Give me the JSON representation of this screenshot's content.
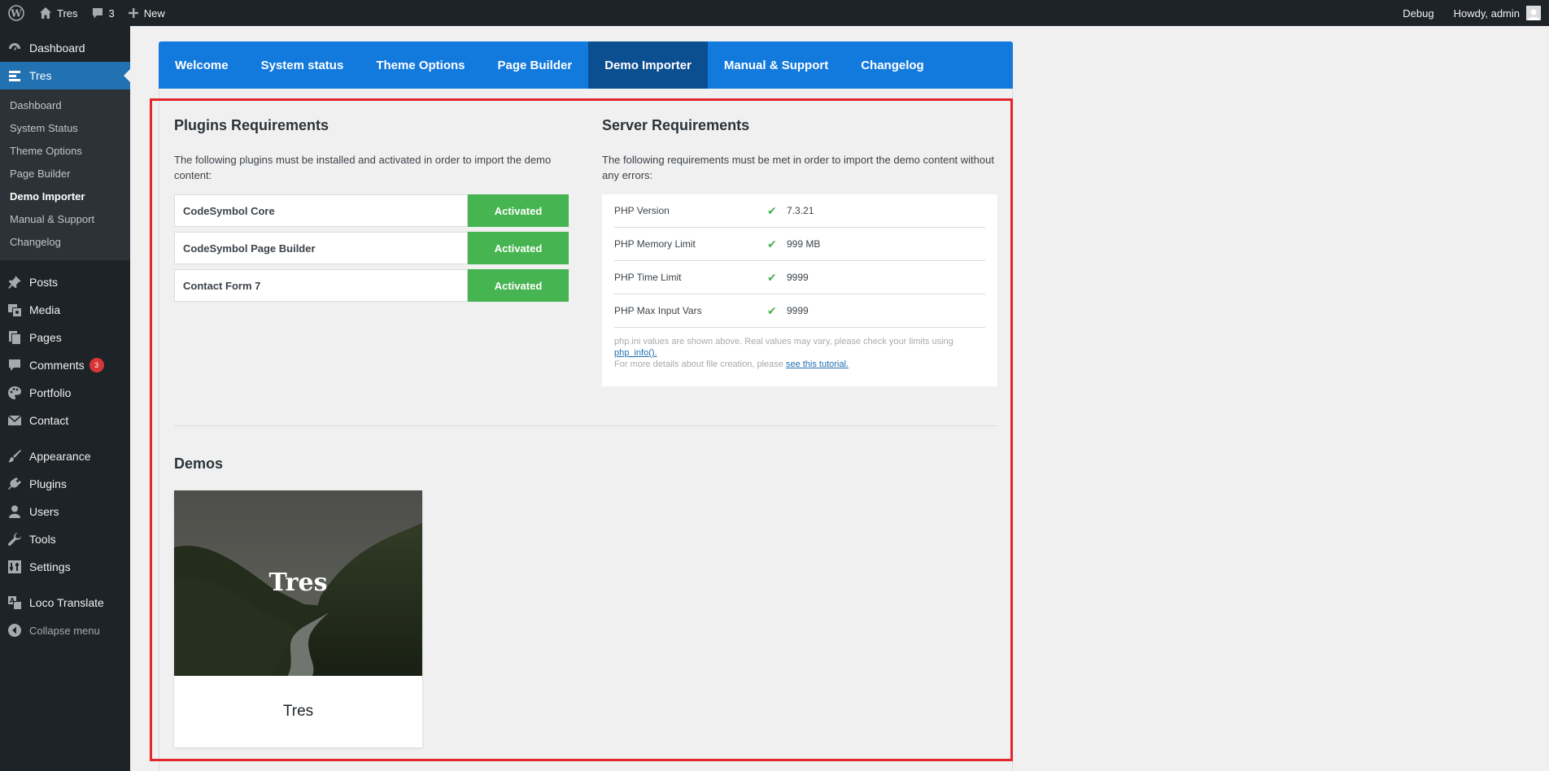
{
  "adminbar": {
    "site_name": "Tres",
    "comments_count": "3",
    "new_label": "New",
    "debug_label": "Debug",
    "howdy_label": "Howdy, admin"
  },
  "sidebar": {
    "dashboard": "Dashboard",
    "current": "Tres",
    "submenu": [
      "Dashboard",
      "System Status",
      "Theme Options",
      "Page Builder",
      "Demo Importer",
      "Manual & Support",
      "Changelog"
    ],
    "posts": "Posts",
    "media": "Media",
    "pages": "Pages",
    "comments": "Comments",
    "comments_badge": "3",
    "portfolio": "Portfolio",
    "contact": "Contact",
    "appearance": "Appearance",
    "plugins": "Plugins",
    "users": "Users",
    "tools": "Tools",
    "settings": "Settings",
    "loco": "Loco Translate",
    "collapse": "Collapse menu"
  },
  "tabs": [
    "Welcome",
    "System status",
    "Theme Options",
    "Page Builder",
    "Demo Importer",
    "Manual & Support",
    "Changelog"
  ],
  "plugins": {
    "title": "Plugins Requirements",
    "desc": "The following plugins must be installed and activated in order to import the demo content:",
    "rows": [
      {
        "name": "CodeSymbol Core",
        "status": "Activated"
      },
      {
        "name": "CodeSymbol Page Builder",
        "status": "Activated"
      },
      {
        "name": "Contact Form 7",
        "status": "Activated"
      }
    ]
  },
  "server": {
    "title": "Server Requirements",
    "desc": "The following requirements must be met in order to import the demo content without any errors:",
    "rows": [
      {
        "label": "PHP Version",
        "check": "✔",
        "value": "7.3.21"
      },
      {
        "label": "PHP Memory Limit",
        "check": "✔",
        "value": "999 MB"
      },
      {
        "label": "PHP Time Limit",
        "check": "✔",
        "value": "9999"
      },
      {
        "label": "PHP Max Input Vars",
        "check": "✔",
        "value": "9999"
      }
    ],
    "note_line1": "php.ini values are shown above. Real values may vary, please check your limits using",
    "note_link1": "php_info().",
    "note_line2": "For more details about file creation, please",
    "note_link2": "see this tutorial."
  },
  "demos": {
    "title": "Demos",
    "card_overlay": "Tres",
    "card_name": "Tres"
  },
  "colors": {
    "accent": "#2271b1",
    "tabs_bg": "#1279dd",
    "tab_active": "#0c4f91",
    "activated": "#46b450",
    "highlight": "#e5262b"
  }
}
